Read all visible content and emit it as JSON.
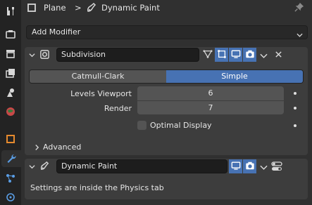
{
  "header": {
    "object_name": "Plane",
    "separator": ">",
    "modifier_context": "Dynamic Paint"
  },
  "toolbar": {
    "add_modifier_label": "Add Modifier"
  },
  "modifiers": [
    {
      "name": "Subdivision",
      "type_icon": "subdivision-square-icon",
      "subdivision_types": [
        "Catmull-Clark",
        "Simple"
      ],
      "selected_type": "Simple",
      "levels_viewport_label": "Levels Viewport",
      "levels_viewport_value": "6",
      "render_label": "Render",
      "render_value": "7",
      "optimal_display_label": "Optimal Display",
      "optimal_display_checked": false,
      "advanced_label": "Advanced"
    },
    {
      "name": "Dynamic Paint",
      "type_icon": "dynamic-paint-brush-icon",
      "info_text": "Settings are inside the Physics tab"
    }
  ],
  "properties_tabs": [
    "tool",
    "render",
    "output",
    "view-layer",
    "scene",
    "world",
    "object",
    "modifiers",
    "particles",
    "physics"
  ],
  "active_tab": "modifiers",
  "colors": {
    "accent_blue": "#4772b3",
    "wrench_active": "#5a9ee6",
    "object_orange": "#e68a2e"
  }
}
